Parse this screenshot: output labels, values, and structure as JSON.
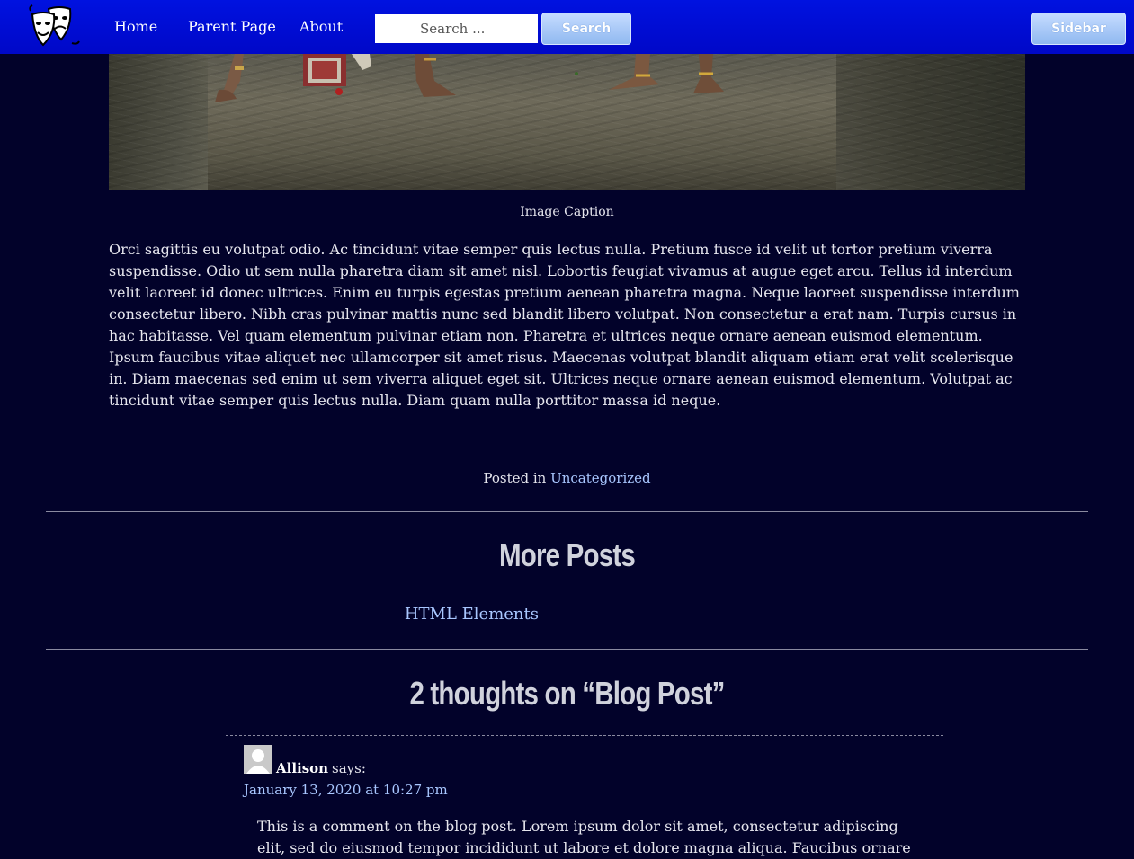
{
  "header": {
    "nav": [
      {
        "label": "Home"
      },
      {
        "label": "Parent Page"
      },
      {
        "label": "About"
      }
    ],
    "search": {
      "placeholder": "Search ...",
      "button_label": "Search"
    },
    "sidebar_button_label": "Sidebar",
    "logo_icon": "theater-masks-icon"
  },
  "article": {
    "image_caption": "Image Caption",
    "body": "Orci sagittis eu volutpat odio. Ac tincidunt vitae semper quis lectus nulla. Pretium fusce id velit ut tortor pretium viverra suspendisse. Odio ut sem nulla pharetra diam sit amet nisl. Lobortis feugiat vivamus at augue eget arcu. Tellus id interdum velit laoreet id donec ultrices. Enim eu turpis egestas pretium aenean pharetra magna. Neque laoreet suspendisse interdum consectetur libero. Nibh cras pulvinar mattis nunc sed blandit libero volutpat. Non consectetur a erat nam. Turpis cursus in hac habitasse. Vel quam elementum pulvinar etiam non. Pharetra et ultrices neque ornare aenean euismod elementum. Ipsum faucibus vitae aliquet nec ullamcorper sit amet risus. Maecenas volutpat blandit aliquam etiam erat velit scelerisque in. Diam maecenas sed enim ut sem viverra aliquet eget sit. Ultrices neque ornare aenean euismod elementum. Volutpat ac tincidunt vitae semper quis lectus nulla. Diam quam nulla porttitor massa id neque.",
    "posted_in_label": "Posted in",
    "category": "Uncategorized"
  },
  "more_posts": {
    "title": "More Posts",
    "previous": "HTML Elements"
  },
  "comments": {
    "title": "2 thoughts on “Blog Post”",
    "items": [
      {
        "author": "Allison",
        "says": "says:",
        "date": "January 13, 2020 at 10:27 pm",
        "text": "This is a comment on the blog post. Lorem ipsum dolor sit amet, consectetur adipiscing elit, sed do eiusmod tempor incididunt ut labore et dolore magna aliqua. Faucibus ornare"
      }
    ]
  },
  "colors": {
    "header_bg": "#0012e0",
    "page_bg": "#02022a",
    "link": "#a9c7ff",
    "button_bg": "#a8c8f5"
  }
}
